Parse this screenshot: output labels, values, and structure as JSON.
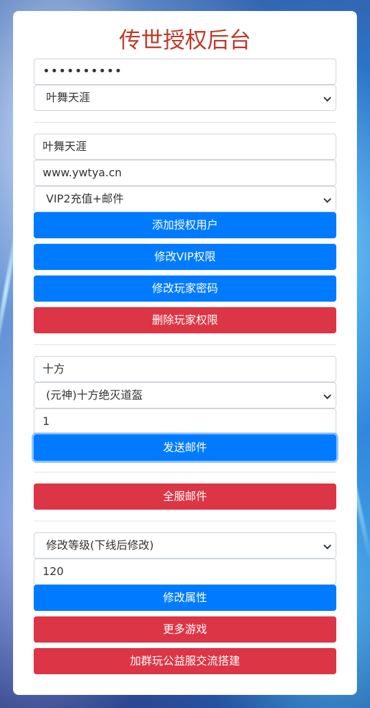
{
  "title": "传世授权后台",
  "auth": {
    "password_value": "••••••••••",
    "server_select": "叶舞天涯"
  },
  "user": {
    "account_value": "叶舞天涯",
    "site_value": "www.ywtya.cn",
    "vip_select": "VIP2充值+邮件",
    "add_button": "添加授权用户",
    "modify_vip_button": "修改VIP权限",
    "modify_password_button": "修改玩家密码",
    "delete_button": "删除玩家权限"
  },
  "mail": {
    "search_value": "十方",
    "item_select": "(元神)十方绝灭道盔",
    "quantity_value": "1",
    "send_button": "发送邮件"
  },
  "server_mail": {
    "button": "全服邮件"
  },
  "attribute": {
    "type_select": "修改等级(下线后修改)",
    "value": "120",
    "modify_button": "修改属性",
    "more_games_button": "更多游戏",
    "join_group_button": "加群玩公益服交流搭建"
  },
  "colors": {
    "title": "#c0392b",
    "primary": "#007bff",
    "danger": "#dc3545"
  }
}
